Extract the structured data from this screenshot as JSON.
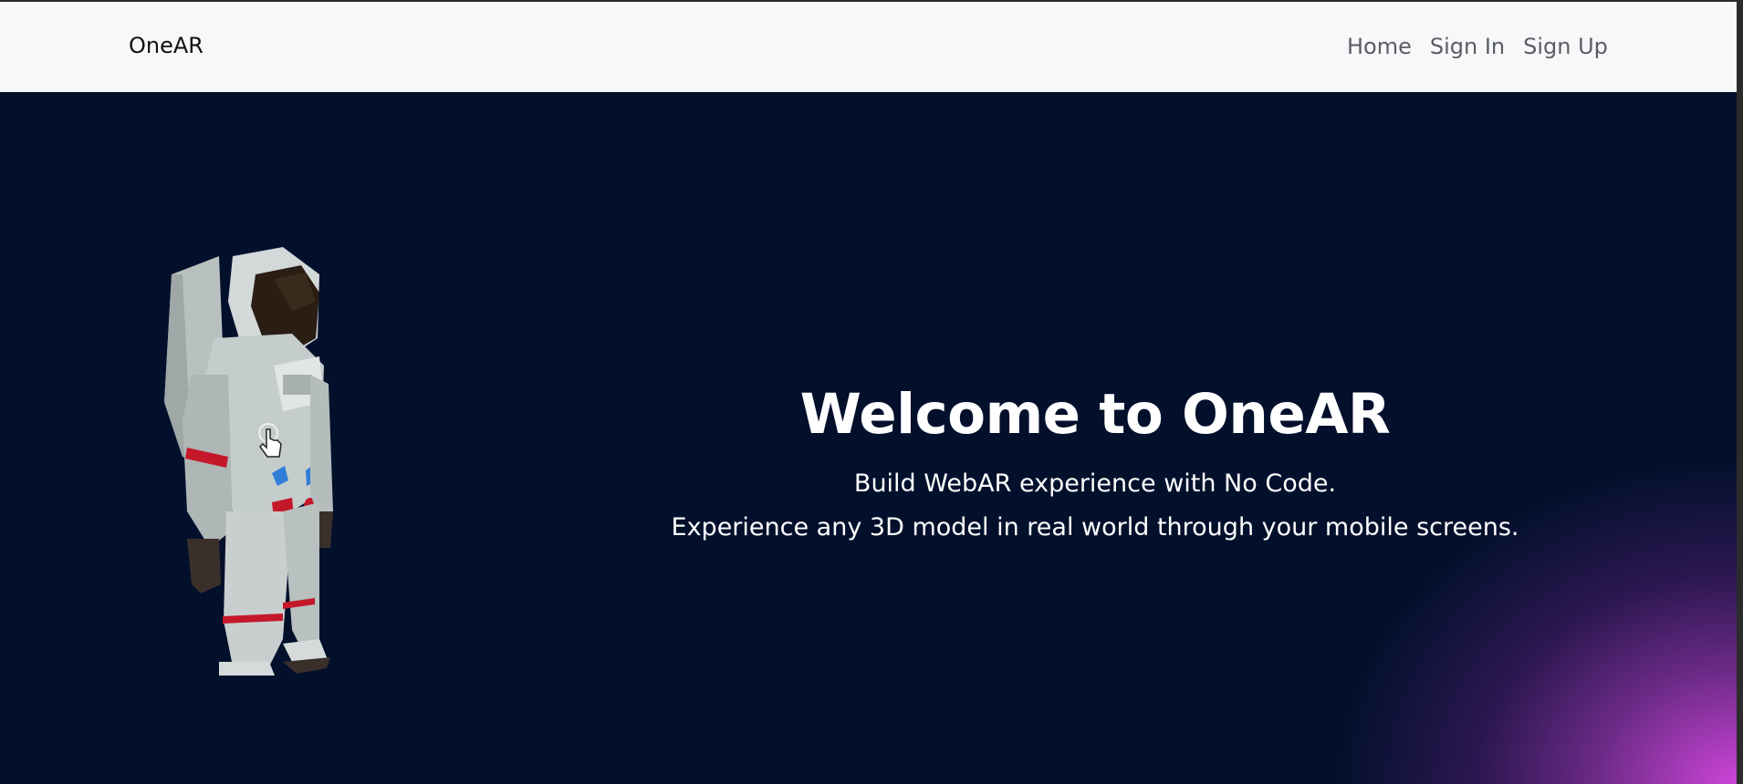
{
  "navbar": {
    "brand": "OneAR",
    "links": [
      {
        "label": "Home"
      },
      {
        "label": "Sign In"
      },
      {
        "label": "Sign Up"
      }
    ]
  },
  "hero": {
    "title": "Welcome to OneAR",
    "line1": "Build WebAR experience with No Code.",
    "line2": "Experience any 3D model in real world through your mobile screens.",
    "model_icon": "astronaut-3d-model",
    "cursor_icon": "hand-pointer-icon"
  },
  "colors": {
    "navbar_bg": "#f7f8fa",
    "hero_bg": "#02102c",
    "accent_glow": "#cc45d8",
    "text_light": "#ffffff",
    "nav_text": "#5a5d61"
  }
}
